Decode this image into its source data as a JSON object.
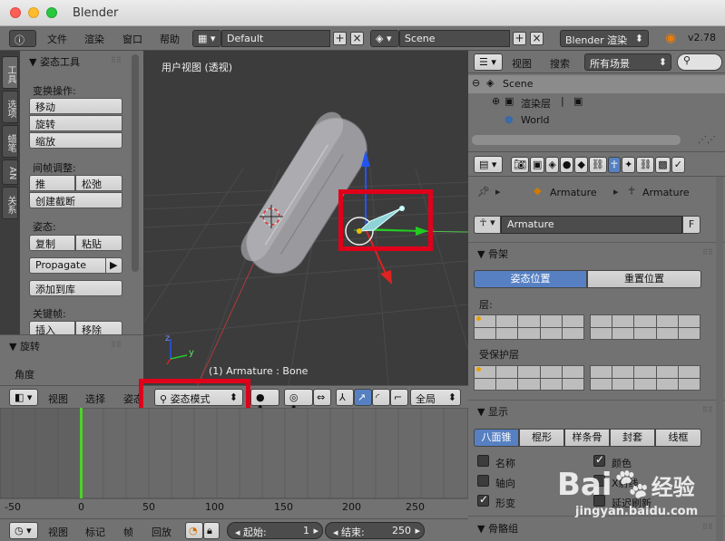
{
  "window": {
    "title": "Blender"
  },
  "topbar": {
    "menus": [
      "文件",
      "渲染",
      "窗口",
      "帮助"
    ],
    "layout": "Default",
    "scene": "Scene",
    "engine": "Blender 渲染",
    "version": "v2.78"
  },
  "toolshelf": {
    "tabs": [
      "工具",
      "选项",
      "蜡笔",
      "AN",
      "关系"
    ],
    "panel_title": "姿态工具",
    "transform_label": "变换操作:",
    "transform_buttons": [
      "移动",
      "旋转",
      "缩放"
    ],
    "inbetween_label": "间帧调整:",
    "push": "推",
    "relax": "松弛",
    "breakdowner": "创建截断",
    "pose_label": "姿态:",
    "copy": "复制",
    "paste": "粘贴",
    "propagate": "Propagate",
    "add_to_library": "添加到库",
    "keyframe_label": "关键帧:",
    "insert": "插入",
    "remove": "移除"
  },
  "redo_panel": {
    "title": "旋转",
    "angle_label": "角度"
  },
  "viewport": {
    "title": "用户视图 (透视)",
    "info": "(1) Armature : Bone",
    "axis_z": "z",
    "axis_y": "y"
  },
  "viewport_header": {
    "menus": [
      "视图",
      "选择",
      "姿态"
    ],
    "mode": "姿态模式",
    "orientation": "全局"
  },
  "timeline": {
    "ticks": [
      "-50",
      "0",
      "50",
      "100",
      "150",
      "200",
      "250"
    ],
    "current_frame": 1,
    "footer_menus": [
      "视图",
      "标记",
      "帧",
      "回放"
    ],
    "start_label": "起始:",
    "start_value": "1",
    "end_label": "结束:",
    "end_value": "250"
  },
  "outliner": {
    "menus": [
      "视图",
      "搜索"
    ],
    "filter": "所有场景",
    "items": [
      "Scene",
      "渲染层",
      "World"
    ]
  },
  "properties": {
    "breadcrumb": [
      "Armature",
      "Armature"
    ],
    "datablock": "Armature",
    "datablock_flag": "F",
    "skeleton": {
      "title": "骨架",
      "pose_position": "姿态位置",
      "rest_position": "重置位置",
      "layers_label": "层:",
      "protected_label": "受保护层"
    },
    "display": {
      "title": "显示",
      "types": [
        "八面锥",
        "棍形",
        "样条骨",
        "封套",
        "线框"
      ],
      "names": "名称",
      "axes": "轴向",
      "shapes": "形变",
      "colors": "颜色",
      "xray": "X射线",
      "delay": "延迟刷新"
    },
    "bone_groups_title": "骨骼组"
  },
  "watermark": {
    "brand": "Bai",
    "brand2": "经验",
    "url": "jingyan.baidu.com"
  },
  "colors": {
    "accent": "#5680c2",
    "highlight_box": "#e0001a",
    "playhead": "#4fd12a"
  }
}
